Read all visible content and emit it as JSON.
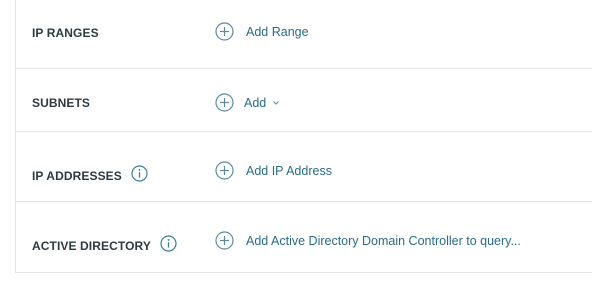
{
  "rows": [
    {
      "label": "IP RANGES",
      "has_info": false,
      "action": "Add Range",
      "action_icon": "plus-circle-icon",
      "dropdown": false
    },
    {
      "label": "SUBNETS",
      "has_info": false,
      "action": "Add",
      "action_icon": "plus-circle-icon",
      "dropdown": true
    },
    {
      "label": "IP ADDRESSES",
      "has_info": true,
      "action": "Add IP Address",
      "action_icon": "plus-circle-icon",
      "dropdown": false
    },
    {
      "label": "ACTIVE DIRECTORY",
      "has_info": true,
      "action": "Add Active Directory Domain Controller to query...",
      "action_icon": "plus-circle-icon",
      "dropdown": false
    }
  ],
  "colors": {
    "label": "#2d3a42",
    "link": "#2b6b86",
    "icon": "#5d8aa1",
    "divider": "#e3e6e8"
  }
}
